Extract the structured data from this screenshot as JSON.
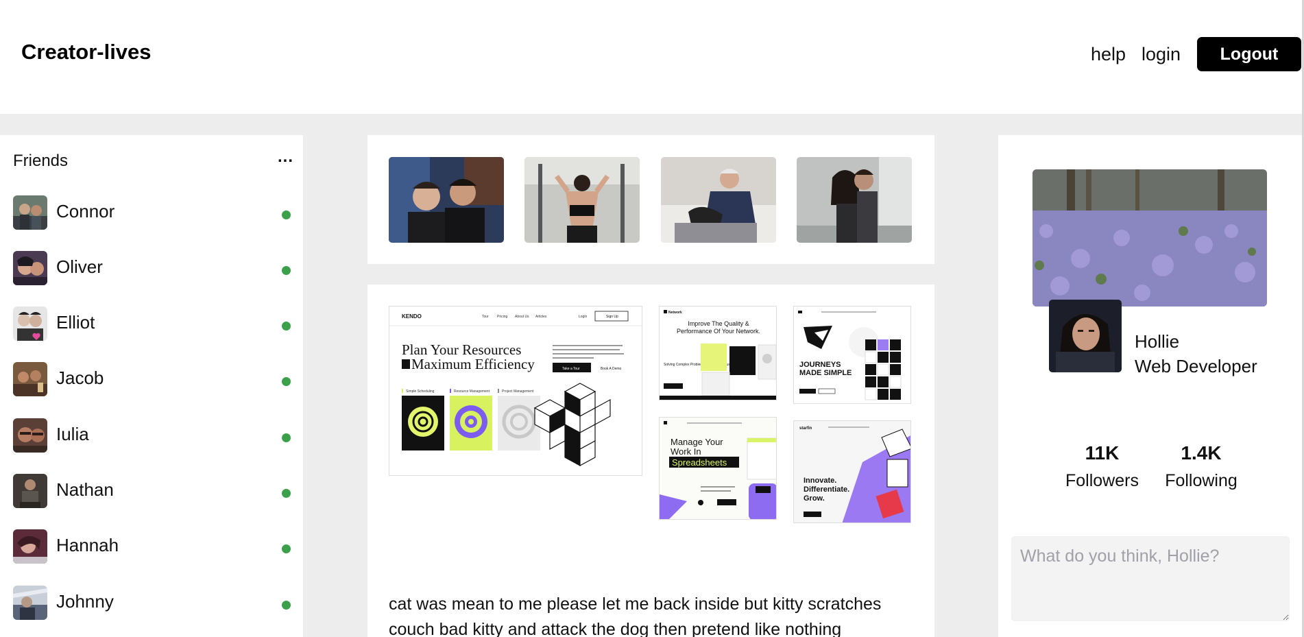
{
  "header": {
    "brand": "Creator-lives",
    "nav": {
      "help": "help",
      "login": "login"
    },
    "logout_label": "Logout"
  },
  "friends": {
    "title": "Friends",
    "more": "...",
    "online_color": "#3aa14a",
    "items": [
      {
        "name": "Connor",
        "online": true
      },
      {
        "name": "Oliver",
        "online": true
      },
      {
        "name": "Elliot",
        "online": true
      },
      {
        "name": "Jacob",
        "online": true
      },
      {
        "name": "Iulia",
        "online": true
      },
      {
        "name": "Nathan",
        "online": true
      },
      {
        "name": "Hannah",
        "online": true
      },
      {
        "name": "Johnny",
        "online": true
      }
    ]
  },
  "stories": [
    "story-photo",
    "story-photo",
    "story-photo",
    "story-photo"
  ],
  "post": {
    "images": {
      "kendo": {
        "logo": "KENDO",
        "nav": [
          "Tour",
          "Pricing",
          "About Us",
          "Articles",
          "Login"
        ],
        "signup": "Sign Up",
        "headline_1": "Plan Your Resources",
        "headline_2": "Maximum Efficiency",
        "cta_1": "Take a Tour",
        "cta_2": "Book A Demo",
        "features": [
          "Simple Scheduling",
          "Resource Management",
          "Project Management"
        ]
      },
      "network": {
        "logo": "Network",
        "headline_1": "Improve The Quality &",
        "headline_2": "Performance Of Your Network.",
        "sub": "Solving Complex Problems Across All Industries."
      },
      "journeys": {
        "headline_1": "JOURNEYS",
        "headline_2": "MADE SIMPLE"
      },
      "spreadsheets": {
        "headline_1": "Manage Your",
        "headline_2": "Work In",
        "highlight": "Spreadsheets"
      },
      "starfin": {
        "logo": "starfin",
        "headline_1": "Innovate.",
        "headline_2": "Differentiate.",
        "headline_3": "Grow."
      }
    },
    "text_line_1": "cat was mean to me please let me back inside but kitty scratches",
    "text_line_2": "couch bad kitty and attack the dog then pretend like nothing"
  },
  "profile": {
    "name": "Hollie",
    "role": "Web Developer",
    "followers_value": "11K",
    "followers_label": "Followers",
    "following_value": "1.4K",
    "following_label": "Following",
    "composer_placeholder": "What do you think, Hollie?"
  }
}
